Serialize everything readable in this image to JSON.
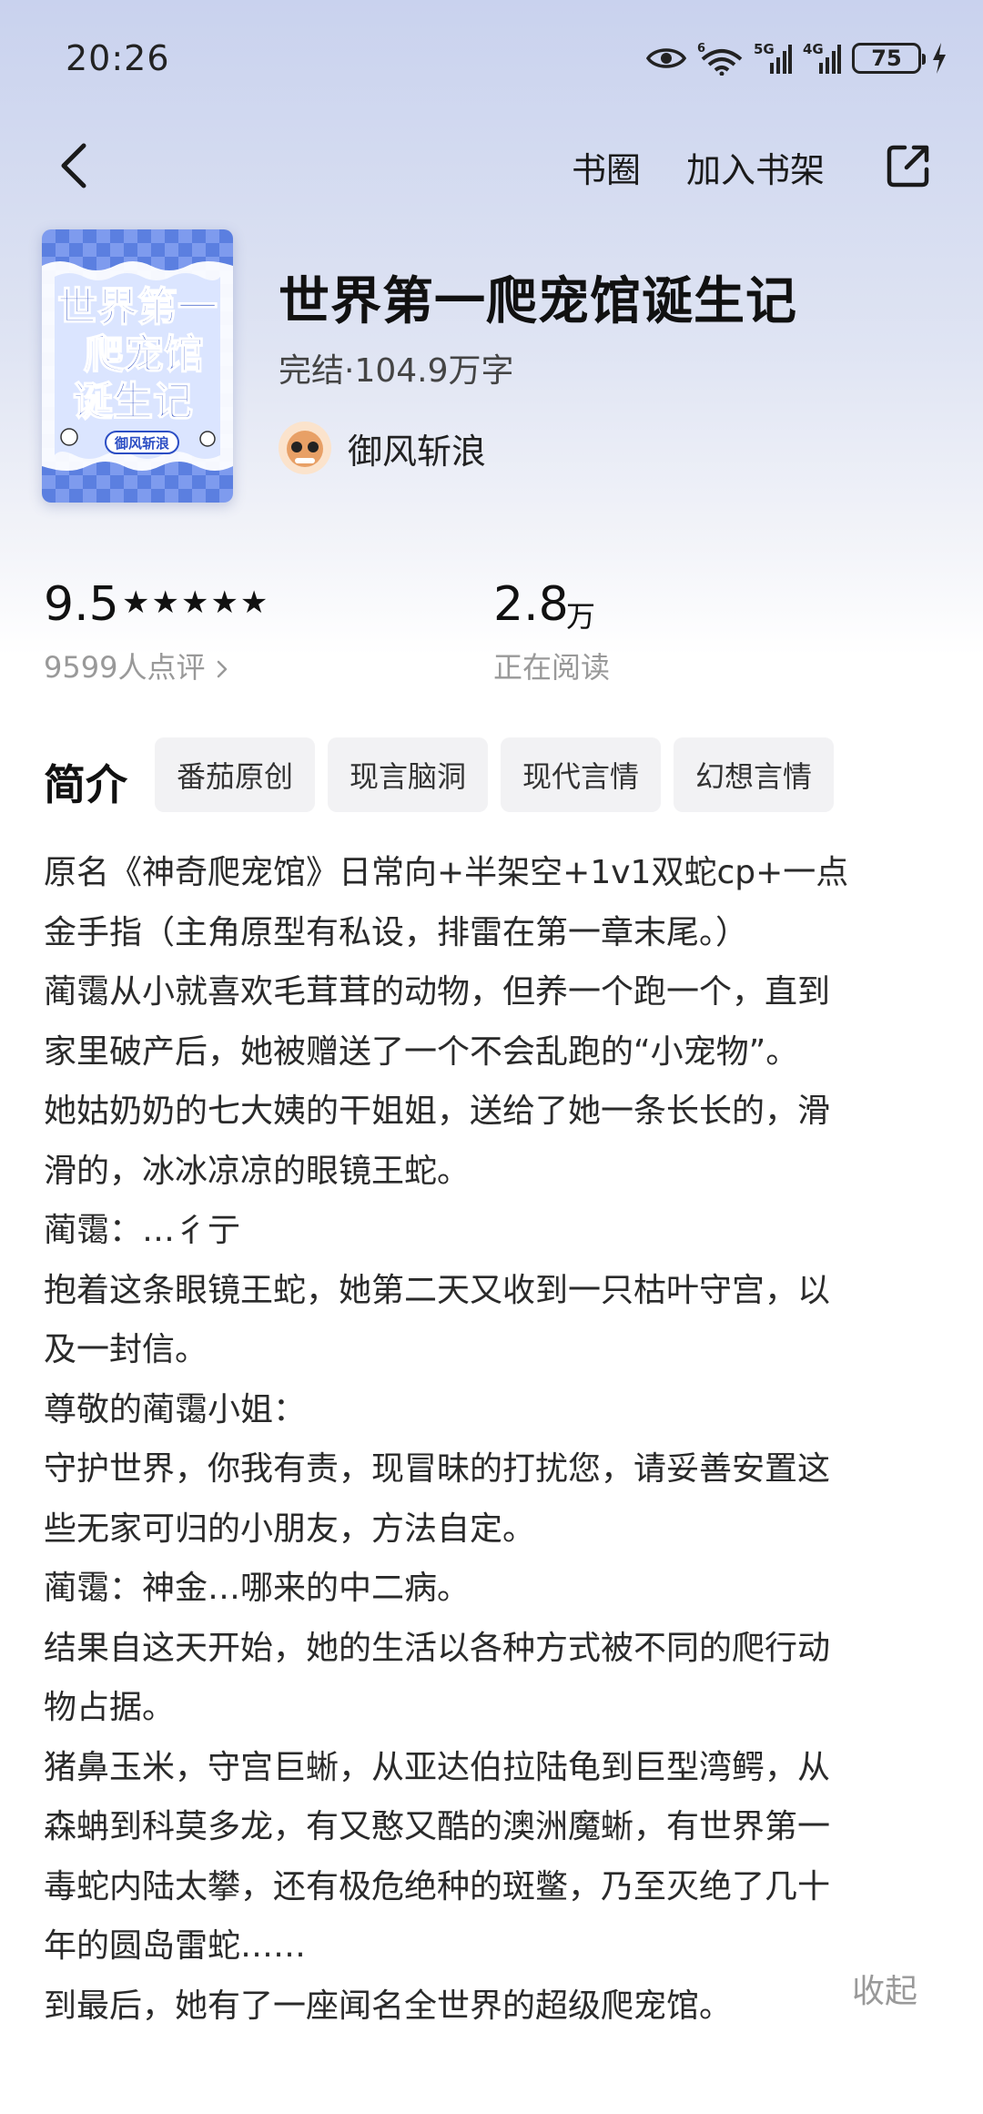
{
  "status_bar": {
    "time": "20:26",
    "battery": "75",
    "signal_labels": [
      "6",
      "5G",
      "4G"
    ]
  },
  "nav": {
    "back_icon": "chevron-left-icon",
    "circle_label": "书圈",
    "add_shelf_label": "加入书架",
    "share_icon": "share-icon"
  },
  "book": {
    "title": "世界第一爬宠馆诞生记",
    "meta": "完结·104.9万字",
    "author": "御风斩浪",
    "cover_title_lines": [
      "世界第一",
      "爬宠馆",
      "诞生记"
    ],
    "cover_author": "御风斩浪"
  },
  "stats": {
    "rating": "9.5",
    "stars": "★★★★★",
    "review_count": "9599人点评",
    "readers_num": "2.8",
    "readers_unit": "万",
    "readers_label": "正在阅读"
  },
  "intro": {
    "title": "简介",
    "tags": [
      "番茄原创",
      "现言脑洞",
      "现代言情",
      "幻想言情"
    ],
    "lines": [
      "原名《神奇爬宠馆》日常向+半架空+1v1双蛇cp+一点",
      "金手指（主角原型有私设，排雷在第一章末尾。）",
      "蔺霭从小就喜欢毛茸茸的动物，但养一个跑一个，直到",
      "家里破产后，她被赠送了一个不会乱跑的“小宠物”。",
      "她姑奶奶的七大姨的干姐姐，送给了她一条长长的，滑",
      "滑的，冰冰凉凉的眼镜王蛇。",
      "蔺霭：…彳亍",
      "抱着这条眼镜王蛇，她第二天又收到一只枯叶守宫，以",
      "及一封信。",
      "尊敬的蔺霭小姐：",
      "守护世界，你我有责，现冒昧的打扰您，请妥善安置这",
      "些无家可归的小朋友，方法自定。",
      "蔺霭：神金…哪来的中二病。",
      "结果自这天开始，她的生活以各种方式被不同的爬行动",
      "物占据。",
      "猪鼻玉米，守宫巨蜥，从亚达伯拉陆龟到巨型湾鳄，从",
      "森蚺到科莫多龙，有又憨又酷的澳洲魔蜥，有世界第一",
      "毒蛇内陆太攀，还有极危绝种的斑鳖，乃至灭绝了几十",
      "年的圆岛雷蛇……",
      "到最后，她有了一座闻名全世界的超级爬宠馆。"
    ],
    "collapse_label": "收起"
  }
}
